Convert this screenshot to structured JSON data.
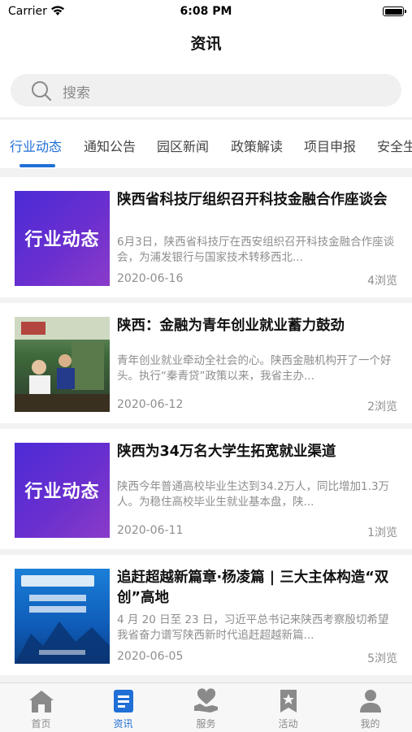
{
  "status_bar": {
    "carrier": "Carrier",
    "time": "6:08 PM"
  },
  "nav": {
    "title": "资讯"
  },
  "search": {
    "placeholder": "搜索"
  },
  "tabs": [
    {
      "label": "行业动态",
      "active": true
    },
    {
      "label": "通知公告"
    },
    {
      "label": "园区新闻"
    },
    {
      "label": "政策解读"
    },
    {
      "label": "项目申报"
    },
    {
      "label": "安全生产"
    }
  ],
  "articles": [
    {
      "thumb_text": "行业动态",
      "title": "陕西省科技厅组织召开科技金融合作座谈会",
      "summary": "6月3日，陕西省科技厅在西安组织召开科技金融合作座谈会，为浦发银行与国家技术转移西北...",
      "date": "2020-06-16",
      "views": "4浏览"
    },
    {
      "thumb_text": "",
      "title": "陕西：金融为青年创业就业蓄力鼓劲",
      "summary": "青年创业就业牵动全社会的心。陕西金融机构开了一个好头。执行“秦青贷”政策以来，我省主办...",
      "date": "2020-06-12",
      "views": "2浏览"
    },
    {
      "thumb_text": "行业动态",
      "title": "陕西为34万名大学生拓宽就业渠道",
      "summary": "陕西今年普通高校毕业生达到34.2万人，同比增加1.3万人。为稳住高校毕业生就业基本盘，陕...",
      "date": "2020-06-11",
      "views": "1浏览"
    },
    {
      "thumb_text": "",
      "title": "追赶超越新篇章·杨凌篇 | 三大主体构造“双创”高地",
      "summary": "4 月 20 日至 23 日，习近平总书记来陕西考察殷切希望我省奋力谱写陕西新时代追赶超越新篇...",
      "date": "2020-06-05",
      "views": "5浏览"
    }
  ],
  "tabbar": [
    {
      "label": "首页",
      "icon": "home-icon"
    },
    {
      "label": "资讯",
      "icon": "news-icon",
      "active": true
    },
    {
      "label": "服务",
      "icon": "service-icon"
    },
    {
      "label": "活动",
      "icon": "activity-icon"
    },
    {
      "label": "我的",
      "icon": "profile-icon"
    }
  ],
  "colors": {
    "accent": "#1f6fd6",
    "inactive": "#8a8a8a",
    "thumb_purple": "#5b2fd0"
  }
}
